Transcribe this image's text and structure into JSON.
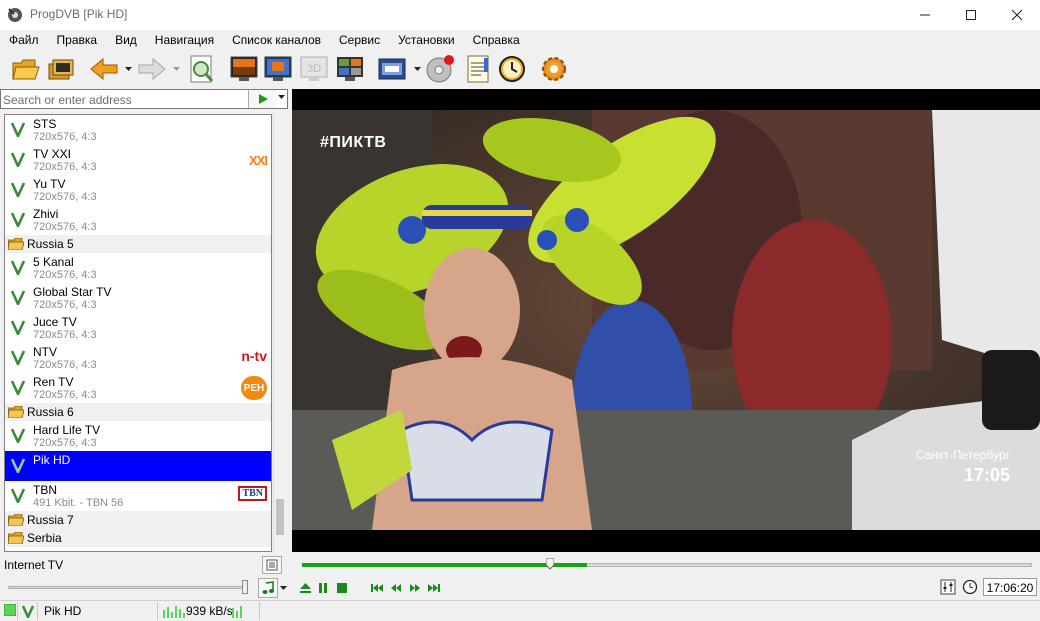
{
  "window": {
    "title": "ProgDVB [Pik HD]"
  },
  "menu": [
    "Файл",
    "Правка",
    "Вид",
    "Навигация",
    "Список каналов",
    "Сервис",
    "Установки",
    "Справка"
  ],
  "toolbar": {
    "icons": [
      "open-folder-icon",
      "channels-icon",
      "back-arrow-icon",
      "forward-arrow-icon",
      "scan-icon",
      "tv-screen-icon",
      "monitor-icon",
      "3d-icon",
      "multi-screen-icon",
      "epg-icon",
      "disc-record-icon",
      "notepad-icon",
      "scheduler-clock-icon",
      "settings-gear-icon"
    ],
    "label_3d": "3D"
  },
  "address": {
    "placeholder": "Search or enter address",
    "value": ""
  },
  "channel_list": [
    {
      "kind": "channel",
      "name": "STS",
      "info": "720x576, 4:3",
      "logo": ""
    },
    {
      "kind": "channel",
      "name": "TV XXI",
      "info": "720x576, 4:3",
      "logo": "XXI"
    },
    {
      "kind": "channel",
      "name": "Yu TV",
      "info": "720x576, 4:3",
      "logo": ""
    },
    {
      "kind": "channel",
      "name": "Zhivi",
      "info": "720x576, 4:3",
      "logo": ""
    },
    {
      "kind": "group",
      "name": "Russia 5"
    },
    {
      "kind": "channel",
      "name": "5 Kanal",
      "info": "720x576, 4:3",
      "logo": ""
    },
    {
      "kind": "channel",
      "name": "Global Star TV",
      "info": "720x576, 4:3",
      "logo": ""
    },
    {
      "kind": "channel",
      "name": "Juce TV",
      "info": "720x576, 4:3",
      "logo": ""
    },
    {
      "kind": "channel",
      "name": "NTV",
      "info": "720x576, 4:3",
      "logo": "n-tv"
    },
    {
      "kind": "channel",
      "name": "Ren TV",
      "info": "720x576, 4:3",
      "logo": "РЕН"
    },
    {
      "kind": "group",
      "name": "Russia 6"
    },
    {
      "kind": "channel",
      "name": "Hard Life TV",
      "info": "720x576, 4:3",
      "logo": ""
    },
    {
      "kind": "channel",
      "name": "Pik HD",
      "info": "",
      "logo": "",
      "selected": true
    },
    {
      "kind": "channel",
      "name": "TBN",
      "info": "491 Kbit. - TBN 56",
      "logo": "TBN"
    },
    {
      "kind": "group",
      "name": "Russia 7"
    },
    {
      "kind": "group",
      "name": "Serbia"
    }
  ],
  "video": {
    "channel_logo": "#ПИКТВ",
    "city": "Санкт-Петербург",
    "time": "17:05"
  },
  "source": {
    "label": "Internet TV"
  },
  "playback": {
    "seek_position": 0.34,
    "seek_buffered": 0.39,
    "volume": 1.0,
    "clock": "17:06:20",
    "controls": [
      "eject-icon",
      "pause-icon",
      "stop-icon",
      "skip-back-icon",
      "rewind-icon",
      "fast-forward-icon",
      "skip-forward-icon"
    ]
  },
  "statusbar": {
    "channel": "Pik HD",
    "bitrate": "939 kB/s"
  },
  "colors": {
    "selection": "#0000ff",
    "accent_green": "#13a313"
  }
}
